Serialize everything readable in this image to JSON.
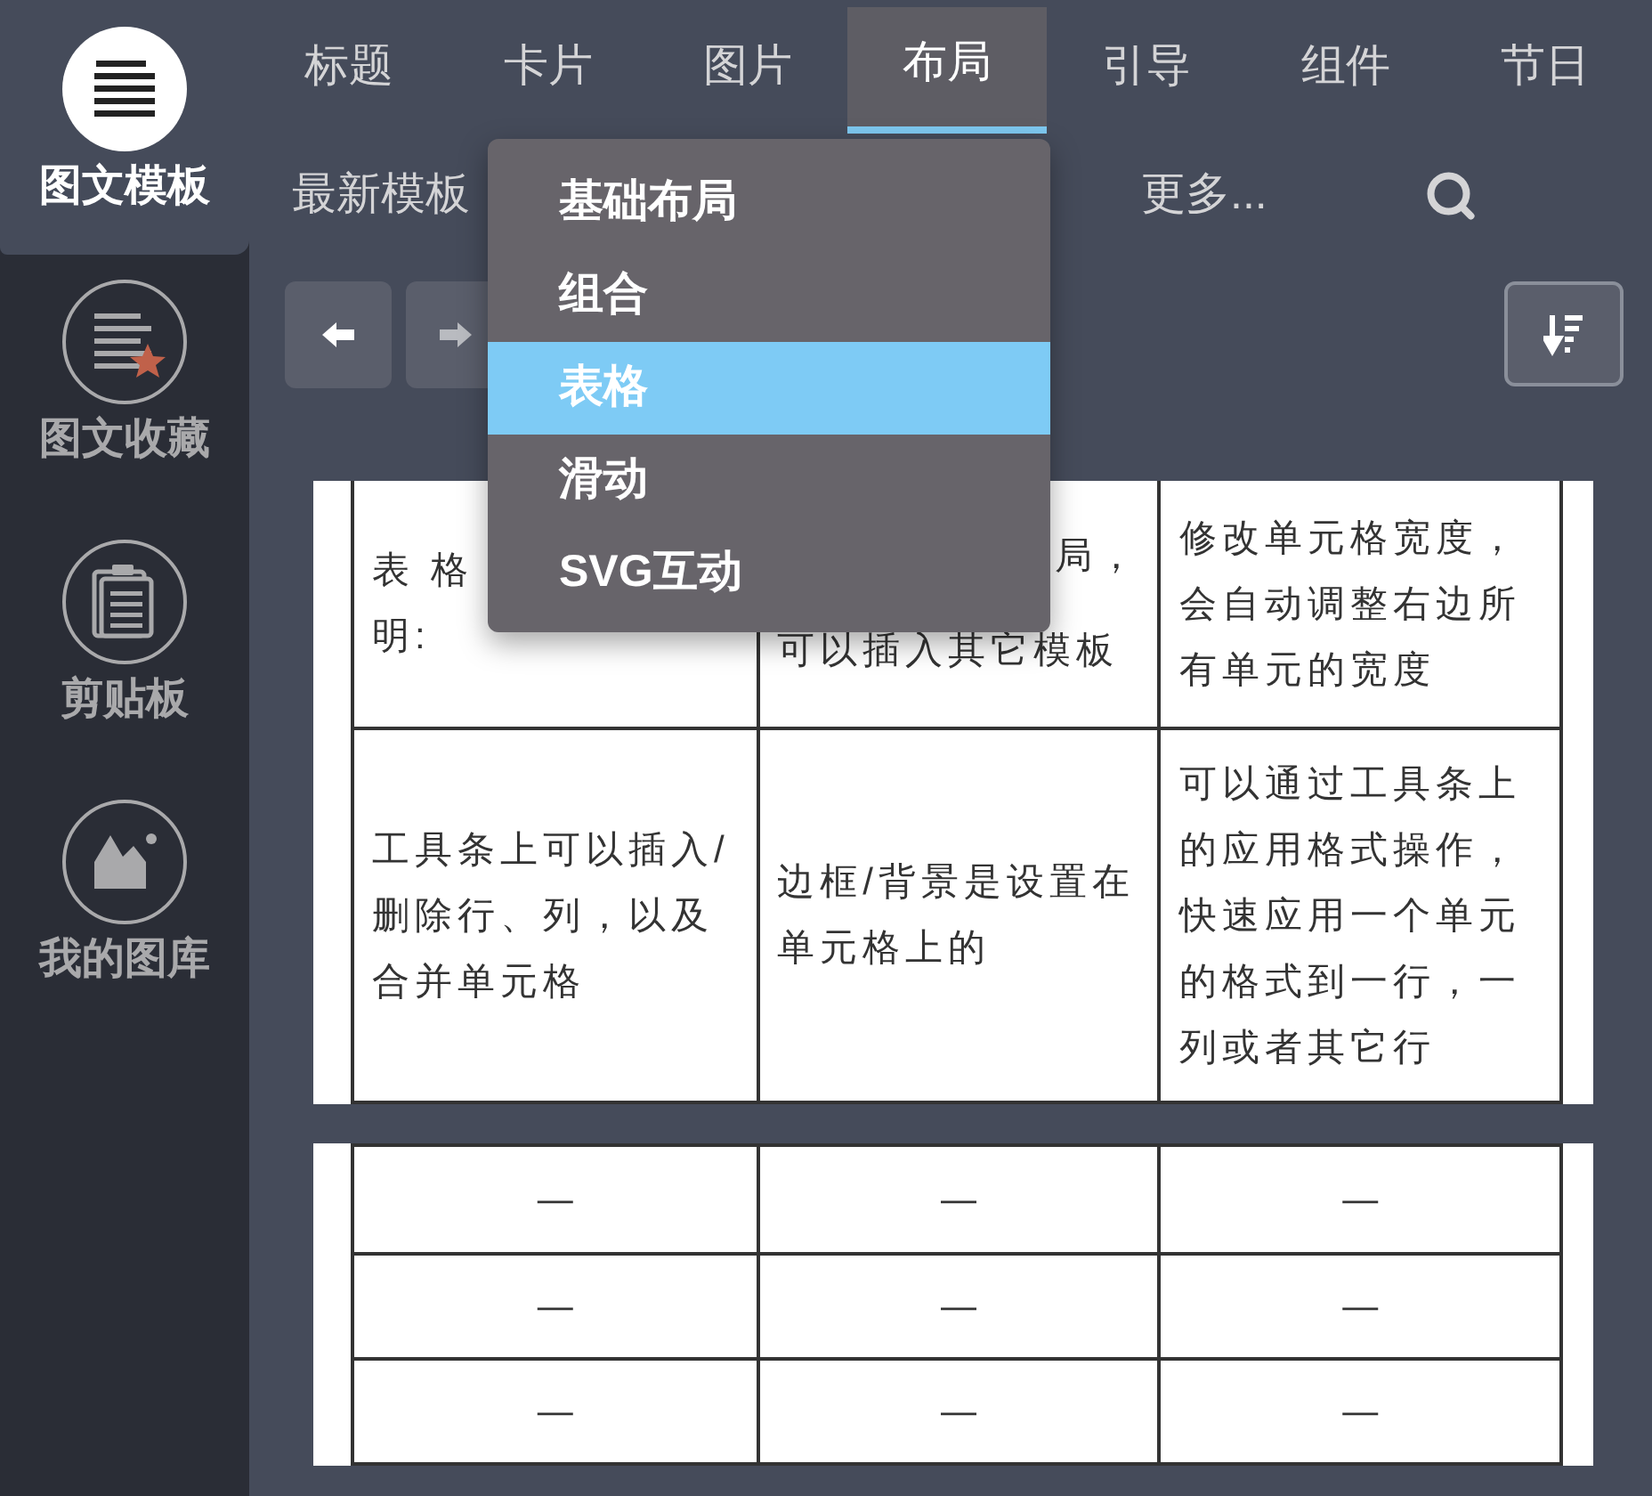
{
  "sidebar": {
    "items": [
      {
        "label": "图文模板",
        "selected": true
      },
      {
        "label": "图文收藏",
        "selected": false
      },
      {
        "label": "剪贴板",
        "selected": false
      },
      {
        "label": "我的图库",
        "selected": false
      }
    ]
  },
  "tabs": [
    {
      "label": "标题",
      "selected": false
    },
    {
      "label": "卡片",
      "selected": false
    },
    {
      "label": "图片",
      "selected": false
    },
    {
      "label": "布局",
      "selected": true
    },
    {
      "label": "引导",
      "selected": false
    },
    {
      "label": "组件",
      "selected": false
    },
    {
      "label": "节日",
      "selected": false
    }
  ],
  "subnav": {
    "items": [
      "最新模板",
      "更多..."
    ]
  },
  "menu": {
    "items": [
      {
        "label": "基础布局",
        "selected": false
      },
      {
        "label": "组合",
        "selected": false
      },
      {
        "label": "表格",
        "selected": true
      },
      {
        "label": "滑动",
        "selected": false
      },
      {
        "label": "SVG互动",
        "selected": false
      }
    ]
  },
  "table_1": {
    "rows": [
      {
        "cells": [
          {
            "fragments": [
              "表 格",
              "明:"
            ]
          },
          {
            "fragments": [
              "局，",
              "可以插入其它模板"
            ]
          },
          {
            "text": "修改单元格宽度，会自动调整右边所有单元的宽度"
          }
        ]
      },
      {
        "cells": [
          {
            "text": "工具条上可以插入/删除行、列，以及合并单元格"
          },
          {
            "text": "边框/背景是设置在单元格上的"
          },
          {
            "text": "可以通过工具条上的应用格式操作，快速应用一个单元的格式到一行，一列或者其它行"
          }
        ]
      }
    ]
  },
  "table_2": {
    "rows": [
      {
        "cells": [
          "—",
          "—",
          "—"
        ]
      },
      {
        "cells": [
          "—",
          "—",
          "—"
        ]
      },
      {
        "cells": [
          "—",
          "—",
          "—"
        ]
      }
    ]
  }
}
